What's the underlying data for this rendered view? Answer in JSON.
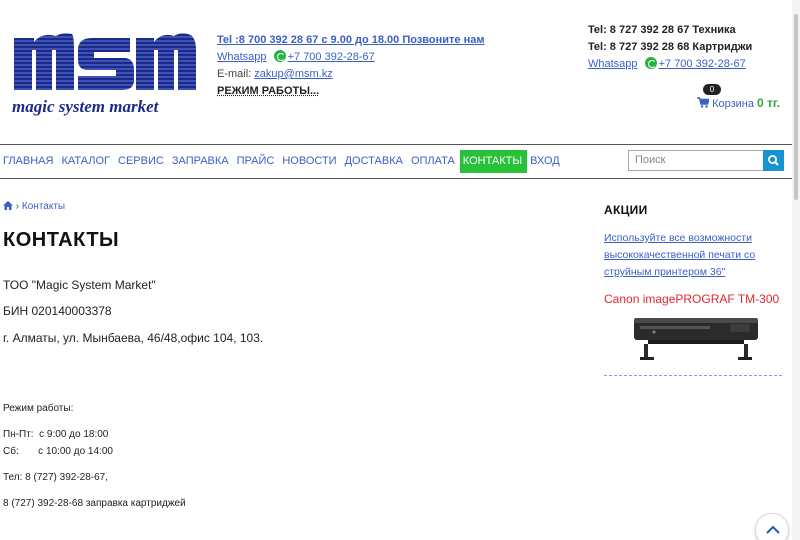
{
  "logo": {
    "word": "msm",
    "tagline": "magic system market"
  },
  "header": {
    "phone_line": "Tel :8 700 392 28 67 с 9.00 до 18.00 Позвоните нам",
    "whatsapp_label": "Whatsapp",
    "whatsapp_number": "+7 700 392-28-67",
    "email_label": "E-mail:",
    "email": "zakup@msm.kz",
    "work_hours": "РЕЖИМ РАБОТЫ...",
    "tel_tech": "Tel: 8 727 392 28 67 Техника",
    "tel_cart": "Tel: 8 727 392 28 68 Картриджи",
    "whatsapp2_label": "Whatsapp",
    "whatsapp2_number": "+7 700 392-28-67",
    "cart_count": "0",
    "cart_label": "Корзина",
    "cart_amount": "0 тг."
  },
  "nav": {
    "items": [
      "ГЛАВНАЯ",
      "КАТАЛОГ",
      "СЕРВИС",
      "ЗАПРАВКА",
      "ПРАЙС",
      "НОВОСТИ",
      "ДОСТАВКА",
      "ОПЛАТА",
      "КОНТАКТЫ",
      "ВХОД"
    ],
    "active_index": 8,
    "search_placeholder": "Поиск"
  },
  "main": {
    "breadcrumb": "Контакты",
    "title": "КОНТАКТЫ",
    "company": "ТОО \"Magic System Market\"",
    "bin": "БИН 020140003378",
    "address": "г. Алматы, ул. Мынбаева, 46/48,офис 104, 103.",
    "hours_title": "Режим работы:",
    "hours_weekdays": "Пн-Пт:  с 9:00 до 18:00",
    "hours_saturday": "Сб:       с 10:00 до 14:00",
    "tel": "Тел: 8 (727) 392-28-67,",
    "tel_refill": "8 (727) 392-28-68 заправка картриджей"
  },
  "sidebar": {
    "title": "АКЦИИ",
    "promo_text": "Используйте все возможности высококачественной печати со струйным принтером 36\"",
    "product_name": "Canon imagePROGRAF TM-300"
  },
  "colors": {
    "accent": "#3a5fc7",
    "active_nav": "#27c23a",
    "sale_red": "#e2262c",
    "search_button": "#1793d1"
  },
  "icons": [
    "home-icon",
    "whatsapp-icon",
    "cart-icon",
    "search-icon",
    "chevron-up-icon"
  ]
}
